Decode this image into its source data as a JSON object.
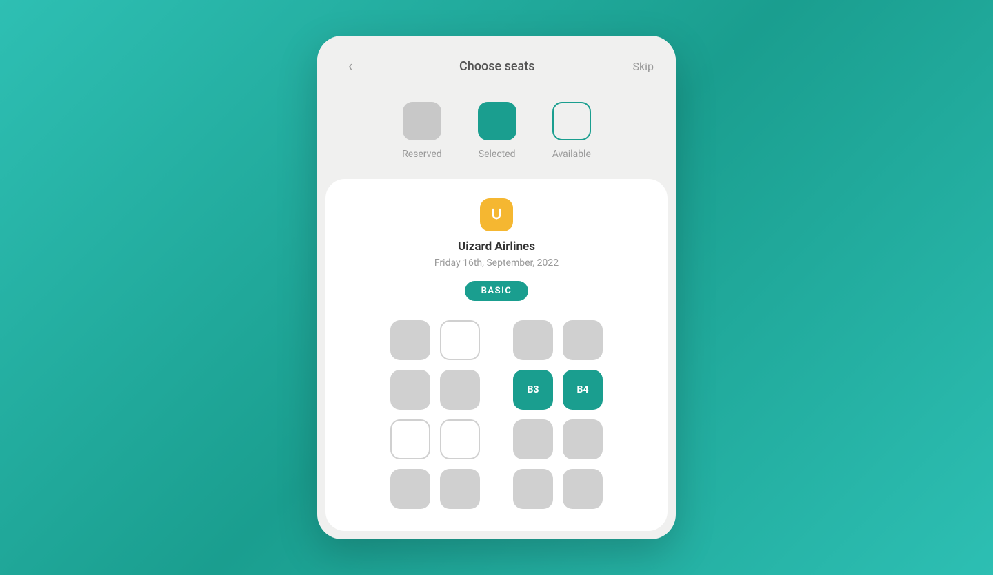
{
  "header": {
    "title": "Choose seats",
    "back_label": "‹",
    "skip_label": "Skip"
  },
  "legend": {
    "items": [
      {
        "type": "reserved",
        "label": "Reserved"
      },
      {
        "type": "selected",
        "label": "Selected"
      },
      {
        "type": "available",
        "label": "Available"
      }
    ]
  },
  "flight": {
    "airline": "Uizard Airlines",
    "date": "Friday 16th, September, 2022",
    "class": "BASIC",
    "logo_symbol": "ʊ"
  },
  "seats": {
    "rows": [
      {
        "left": [
          {
            "id": "A1",
            "state": "reserved"
          },
          {
            "id": "A2",
            "state": "available"
          }
        ],
        "right": [
          {
            "id": "A3",
            "state": "reserved"
          },
          {
            "id": "A4",
            "state": "reserved"
          }
        ]
      },
      {
        "left": [
          {
            "id": "B1",
            "state": "reserved"
          },
          {
            "id": "B2",
            "state": "reserved"
          }
        ],
        "right": [
          {
            "id": "B3",
            "state": "selected",
            "label": "B3"
          },
          {
            "id": "B4",
            "state": "selected",
            "label": "B4"
          }
        ]
      },
      {
        "left": [
          {
            "id": "C1",
            "state": "available"
          },
          {
            "id": "C2",
            "state": "available"
          }
        ],
        "right": [
          {
            "id": "C3",
            "state": "reserved"
          },
          {
            "id": "C4",
            "state": "reserved"
          }
        ]
      },
      {
        "left": [
          {
            "id": "D1",
            "state": "reserved"
          },
          {
            "id": "D2",
            "state": "reserved"
          }
        ],
        "right": [
          {
            "id": "D3",
            "state": "reserved"
          },
          {
            "id": "D4",
            "state": "reserved"
          }
        ]
      }
    ]
  }
}
